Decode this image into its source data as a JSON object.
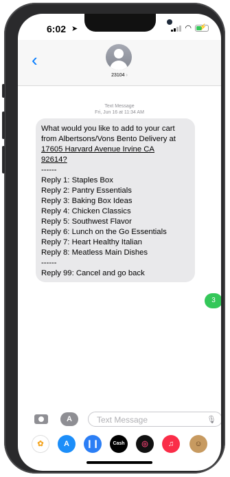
{
  "status_bar": {
    "time": "6:02",
    "location_icon": "location-arrow-icon",
    "signal_icon": "cellular-signal-icon",
    "wifi_icon": "wifi-icon",
    "battery_icon": "battery-charging-icon",
    "battery_level": 0.55
  },
  "nav": {
    "back_icon": "chevron-left-icon",
    "contact_name": "23104",
    "contact_chevron": "›"
  },
  "thread": {
    "meta_line1": "Text Message",
    "meta_line2": "Fri, Jun 16 at 11:34 AM",
    "incoming_lines": [
      "What would you like to add to your cart",
      "from Albertsons/Vons Bento Delivery at",
      "17605 Harvard Avenue Irvine CA",
      "92614?",
      "------",
      "Reply 1: Staples Box",
      "Reply 2: Pantry Essentials",
      "Reply 3: Baking Box Ideas",
      "Reply 4: Chicken Classics",
      "Reply 5: Southwest Flavor",
      "Reply 6: Lunch on the Go Essentials",
      "Reply 7: Heart Healthy Italian",
      "Reply 8: Meatless Main Dishes",
      "------",
      "Reply 99: Cancel and go back"
    ],
    "outgoing": "3"
  },
  "input": {
    "placeholder": "Text Message",
    "camera_icon": "camera-icon",
    "apps_icon": "app-store-icon",
    "mic_icon": "microphone-icon"
  },
  "app_drawer": {
    "apps": [
      {
        "name": "photos-app-icon",
        "color": "#ffffff",
        "glyph": "✿",
        "glyph_color": "#f5a623"
      },
      {
        "name": "app-store-app-icon",
        "color": "#1c8ef9",
        "glyph": "A",
        "glyph_color": "#ffffff"
      },
      {
        "name": "audio-message-app-icon",
        "color": "#2b7ef5",
        "glyph": "❙❙",
        "glyph_color": "#ffffff"
      },
      {
        "name": "apple-cash-app-icon",
        "color": "#000000",
        "glyph": "Cash",
        "glyph_color": "#ffffff"
      },
      {
        "name": "fitness-app-icon",
        "color": "#111111",
        "glyph": "◎",
        "glyph_color": "#e23d6a"
      },
      {
        "name": "music-app-icon",
        "color": "#fa2d48",
        "glyph": "♫",
        "glyph_color": "#ffffff"
      },
      {
        "name": "memoji-app-icon",
        "color": "#c79a60",
        "glyph": "☺",
        "glyph_color": "#5a3a1a"
      }
    ]
  }
}
